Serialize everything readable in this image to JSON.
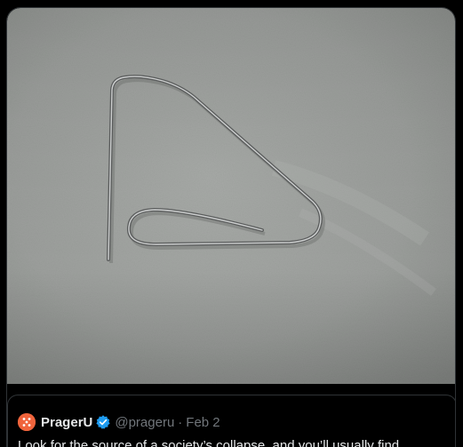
{
  "media": {
    "description_icon": "photo-of-bent-paperclip"
  },
  "quoted_post": {
    "author_name": "PragerU",
    "verified": true,
    "handle": "@prageru",
    "separator": "·",
    "date": "Feb 2",
    "text": "Look for the source of a society’s collapse, and you’ll usually find…"
  },
  "colors": {
    "background": "#000000",
    "border": "#2f3336",
    "primary_text": "#e7e9ea",
    "secondary_text": "#71767b",
    "verified_blue": "#1d9bf0",
    "avatar_orange": "#f0643c"
  }
}
